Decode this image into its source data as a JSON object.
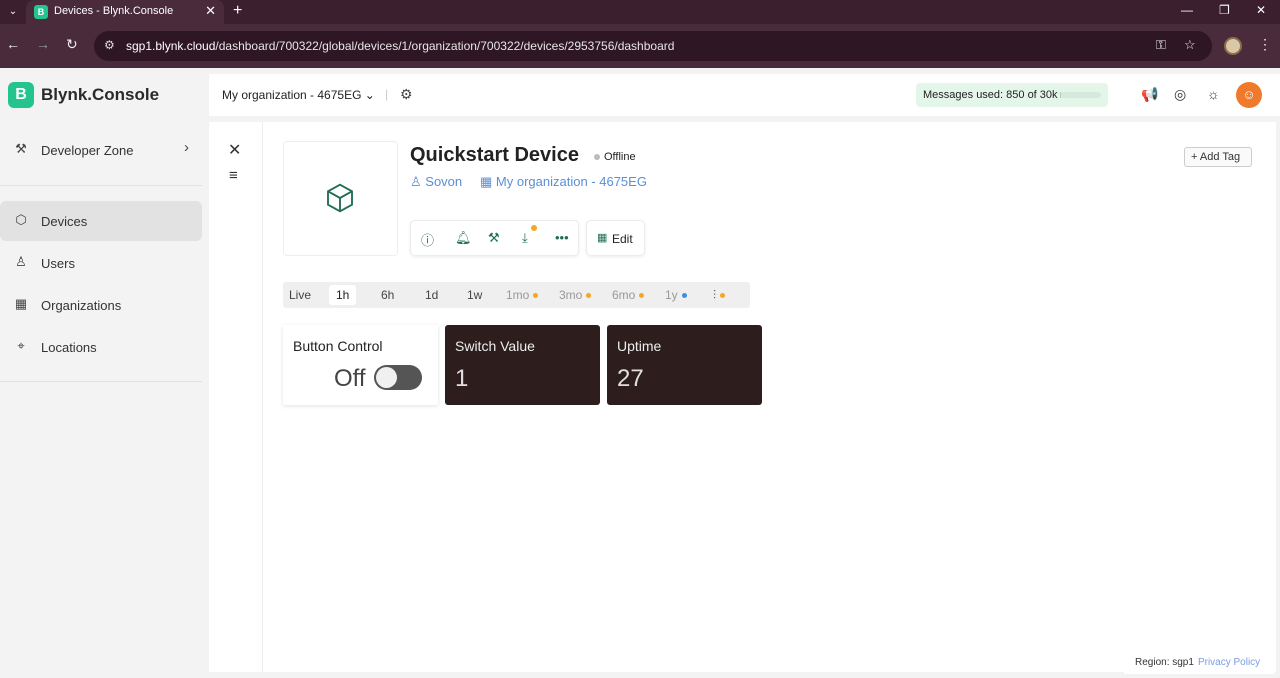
{
  "browser": {
    "tab_title": "Devices - Blynk.Console",
    "tab_favicon": "B",
    "url_host": "sgp1.blynk.cloud",
    "url_path": "/dashboard/700322/global/devices/1/organization/700322/devices/2953756/dashboard"
  },
  "sidebar": {
    "logo_letter": "B",
    "logo_text": "Blynk.Console",
    "developer_zone": "Developer Zone",
    "items": [
      {
        "label": "Devices",
        "icon": "cube-icon"
      },
      {
        "label": "Users",
        "icon": "users-icon"
      },
      {
        "label": "Organizations",
        "icon": "building-icon"
      },
      {
        "label": "Locations",
        "icon": "pin-icon"
      }
    ]
  },
  "topbar": {
    "org_name": "My organization - 4675EG",
    "messages_used": "Messages used: 850 of 30k",
    "messages_fraction": 0.03
  },
  "device": {
    "name": "Quickstart Device",
    "status": "Offline",
    "owner": "Sovon",
    "organization": "My organization - 4675EG",
    "edit_label": "Edit",
    "add_tag_label": "Add Tag"
  },
  "time_ranges": [
    {
      "label": "Live",
      "state": "normal"
    },
    {
      "label": "1h",
      "state": "selected"
    },
    {
      "label": "6h",
      "state": "normal"
    },
    {
      "label": "1d",
      "state": "normal"
    },
    {
      "label": "1w",
      "state": "normal"
    },
    {
      "label": "1mo",
      "state": "dim",
      "dot": "#f5a623"
    },
    {
      "label": "3mo",
      "state": "dim",
      "dot": "#f5a623"
    },
    {
      "label": "6mo",
      "state": "dim",
      "dot": "#f5a623"
    },
    {
      "label": "1y",
      "state": "dim",
      "dot": "#3b8ee8"
    }
  ],
  "widgets": {
    "button_control": {
      "title": "Button Control",
      "value": "Off"
    },
    "switch_value": {
      "title": "Switch Value",
      "value": "1"
    },
    "uptime": {
      "title": "Uptime",
      "value": "27"
    }
  },
  "footer": {
    "region": "Region: sgp1",
    "privacy": "Privacy Policy"
  },
  "colors": {
    "brand": "#23c48e",
    "widget_dark": "#2d1d1d",
    "link": "#5a8fd6",
    "accent_orange": "#f07a2b"
  }
}
